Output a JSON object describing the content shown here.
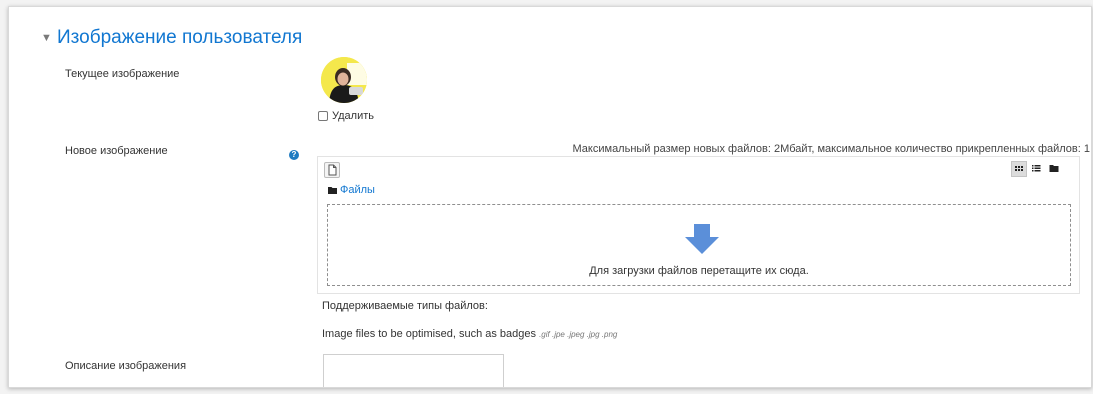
{
  "section": {
    "title": "Изображение пользователя"
  },
  "current_image": {
    "label": "Текущее изображение",
    "delete_label": "Удалить",
    "delete_checked": false
  },
  "new_image": {
    "label": "Новое изображение",
    "max_info": "Максимальный размер новых файлов: 2Мбайт, максимальное количество прикрепленных файлов: 1",
    "breadcrumb": "Файлы",
    "drop_text": "Для загрузки файлов перетащите их сюда.",
    "supported_label": "Поддерживаемые типы файлов:",
    "supported_desc": "Image files to be optimised, such as badges",
    "supported_exts": ".gif .jpe .jpeg .jpg .png",
    "icons": {
      "help": "help-question-icon",
      "add_file": "add-file-icon",
      "view_icons": "grid-view-icon",
      "view_list": "list-view-icon",
      "view_tree": "folder-view-icon",
      "folder": "folder-icon",
      "drop_arrow": "download-arrow-icon"
    }
  },
  "image_description": {
    "label": "Описание изображения",
    "value": ""
  },
  "colors": {
    "accent": "#1177d1",
    "arrow": "#5b8fd9",
    "help": "#1f7bc1"
  }
}
